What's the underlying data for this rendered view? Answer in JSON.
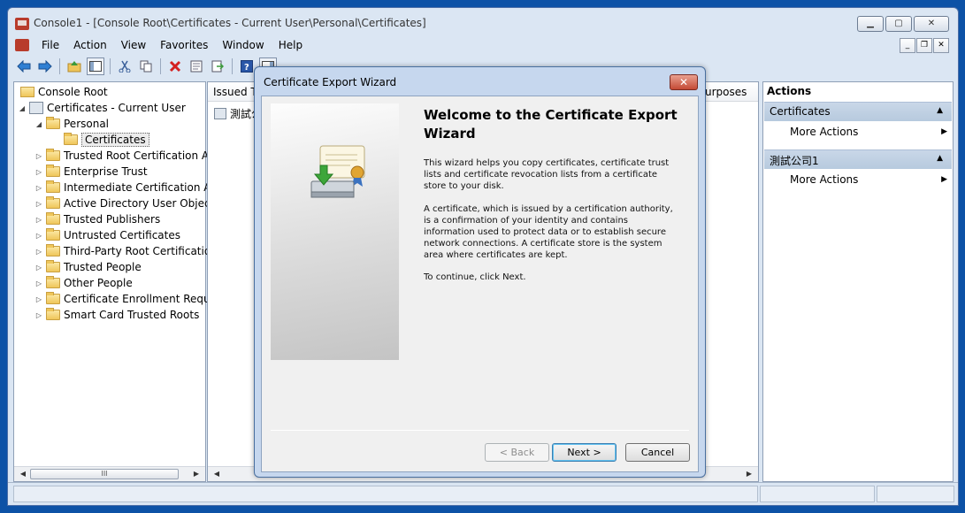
{
  "window": {
    "title": "Console1 - [Console Root\\Certificates - Current User\\Personal\\Certificates]",
    "controls": {
      "minimize": "▁",
      "maximize": "▢",
      "close": "✕"
    }
  },
  "menu": {
    "items": [
      "File",
      "Action",
      "View",
      "Favorites",
      "Window",
      "Help"
    ],
    "mdi_controls": {
      "minimize": "_",
      "restore": "❐",
      "close": "✕"
    }
  },
  "toolbar": {
    "icons": [
      "back-arrow-icon",
      "forward-arrow-icon",
      "up-folder-icon",
      "show-hide-console-tree-icon",
      "cut-icon",
      "copy-icon",
      "delete-icon",
      "properties-icon",
      "export-list-icon",
      "help-icon",
      "show-hide-action-pane-icon"
    ]
  },
  "tree": {
    "root": "Console Root",
    "certificates_current_user": "Certificates - Current User",
    "personal": "Personal",
    "certificates": "Certificates",
    "stores": [
      "Trusted Root Certification Au",
      "Enterprise Trust",
      "Intermediate Certification Au",
      "Active Directory User Object",
      "Trusted Publishers",
      "Untrusted Certificates",
      "Third-Party Root Certificatio",
      "Trusted People",
      "Other People",
      "Certificate Enrollment Reque",
      "Smart Card Trusted Roots"
    ],
    "scroll_thumb": "III"
  },
  "middle": {
    "columns": {
      "issued_to": "Issued To",
      "purposes": "urposes"
    },
    "row_issued_to": "測試公"
  },
  "actions": {
    "title": "Actions",
    "sections": [
      {
        "label": "Certificates",
        "item": "More Actions"
      },
      {
        "label": "測試公司1",
        "item": "More Actions"
      }
    ]
  },
  "dialog": {
    "title": "Certificate Export Wizard",
    "close": "✕",
    "heading": "Welcome to the Certificate Export Wizard",
    "para1": "This wizard helps you copy certificates, certificate trust lists and certificate revocation lists from a certificate store to your disk.",
    "para2": "A certificate, which is issued by a certification authority, is a confirmation of your identity and contains information used to protect data or to establish secure network connections. A certificate store is the system area where certificates are kept.",
    "para3": "To continue, click Next.",
    "buttons": {
      "back": "< Back",
      "next": "Next >",
      "cancel": "Cancel"
    }
  }
}
